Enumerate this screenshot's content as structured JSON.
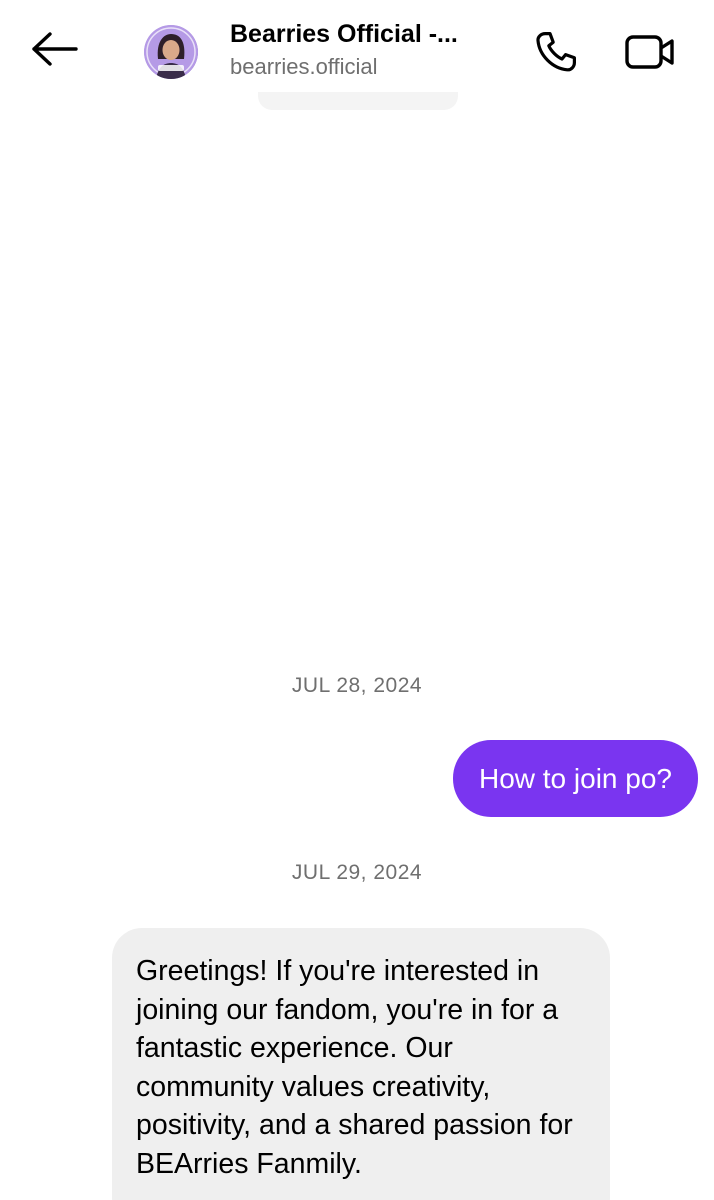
{
  "header": {
    "title": "Bearries Official -...",
    "subtitle": "bearries.official",
    "icons": {
      "back": "arrow-left-icon",
      "call": "phone-icon",
      "video": "video-camera-icon"
    }
  },
  "conversation": {
    "date_1": "JUL 28, 2024",
    "outgoing_message": "How to join po?",
    "date_2": "JUL 29, 2024",
    "incoming_message": "Greetings! If you're interested in joining our fandom, you're in for a fantastic experience. Our community values creativity, positivity, and a shared passion for BEArries Fanmily."
  },
  "colors": {
    "outgoing_bubble": "#7a35f0",
    "incoming_bubble": "#efefef",
    "date_text": "#6f6f6f"
  }
}
